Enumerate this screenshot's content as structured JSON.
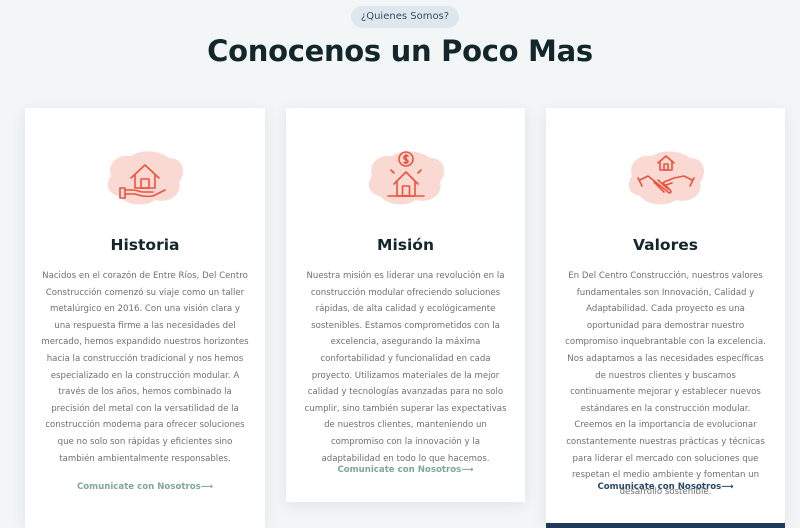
{
  "header": {
    "badge": "¿Quienes Somos?",
    "title": "Conocenos un Poco Mas"
  },
  "cards": [
    {
      "icon": "house-in-hand-icon",
      "title": "Historia",
      "text": "Nacidos en el corazón de Entre Ríos, Del Centro Construcción comenzó su viaje como un taller metalúrgico en 2016. Con una visión clara y una respuesta firme a las necesidades del mercado, hemos expandido nuestros horizontes hacia la construcción tradicional y nos hemos especializado en la construcción modular. A través de los años, hemos combinado la precisión del metal con la versatilidad de la construcción moderna para ofrecer soluciones que no solo son rápidas y eficientes sino también ambientalmente responsables.",
      "link": "Comunicate con Nosotros⟶"
    },
    {
      "icon": "house-dollar-icon",
      "title": "Misión",
      "text": "Nuestra misión es liderar una revolución en la construcción modular ofreciendo soluciones rápidas, de alta calidad y ecológicamente sostenibles. Estamos comprometidos con la excelencia, asegurando la máxima confortabilidad y funcionalidad en cada proyecto. Utilizamos materiales de la mejor calidad y tecnologías avanzadas para no solo cumplir, sino también superar las expectativas de nuestros clientes, manteniendo un compromiso con la innovación y la adaptabilidad en todo lo que hacemos.",
      "link": "Comunicate con Nosotros⟶"
    },
    {
      "icon": "handshake-house-icon",
      "title": "Valores",
      "text": "En Del Centro Construcción, nuestros valores fundamentales son Innovación, Calidad y Adaptabilidad. Cada proyecto es una oportunidad para demostrar nuestro compromiso inquebrantable con la excelencia. Nos adaptamos a las necesidades específicas de nuestros clientes y buscamos continuamente mejorar y establecer nuevos estándares en la construcción modular. Creemos en la importancia de evolucionar constantemente nuestras prácticas y técnicas para liderar el mercado con soluciones que respetan el medio ambiente y fomentan un desarrollo sostenible.",
      "link": "Comunicate con Nosotros⟶"
    }
  ],
  "colors": {
    "background": "#f3f6f7",
    "heading": "#13262b",
    "body_text": "#6e7074",
    "link": "#7fa79c",
    "link_active": "#294a68",
    "icon_stroke": "#e9533f",
    "icon_splash": "#fbd9d3",
    "badge_bg": "#dfe7ee",
    "accent_bar": "#1e3a5a"
  }
}
